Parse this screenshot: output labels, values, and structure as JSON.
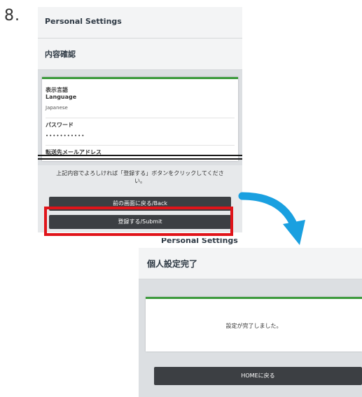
{
  "step_number": "8.",
  "screen1": {
    "header_title": "Personal Settings",
    "subheader": "内容確認",
    "fields": [
      {
        "label_ja": "表示言語",
        "label_en": "Language",
        "value": "Japanese"
      },
      {
        "label": "パスワード",
        "value": "•••••••••••"
      },
      {
        "label": "転送先メールアドレス"
      }
    ],
    "message": "上記内容でよろしければ「登録する」ボタンをクリックしてください。",
    "back_button": "前の画面に戻る/Back",
    "submit_button": "登録する/Submit"
  },
  "screen2": {
    "peek_title": "Personal Settings",
    "header_title": "個人設定完了",
    "message": "設定が完了しました。",
    "home_button": "HOMEに戻る"
  },
  "colors": {
    "highlight": "#e0141a",
    "arrow": "#1aa0e0",
    "accent_line": "#3c9a3c",
    "button": "#3c3f43"
  }
}
